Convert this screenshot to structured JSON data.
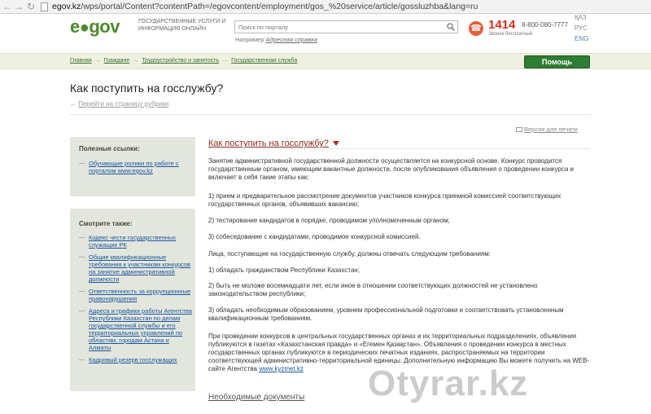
{
  "browser": {
    "url_host": "egov.kz",
    "url_path": "/wps/portal/Content?contentPath=/egovcontent/employment/gos_%20service/article/gossluzhba&lang=ru"
  },
  "header": {
    "logo_prefix": "e",
    "logo_dot": "●",
    "logo_suffix": "gov",
    "tagline": "Государственные услуги и информация онлайн",
    "search_placeholder": "Поиск по порталу",
    "example_label": "Например",
    "example_link": "Адресная справка",
    "hotline": "1414",
    "hotline_number": "8-800-080-7777",
    "hotline_sub": "Звонок бесплатный",
    "lang_kaz": "ҚАЗ",
    "lang_rus": "РУС",
    "lang_eng": "ENG"
  },
  "breadcrumb": {
    "items": [
      "Главная",
      "Гражданe",
      "Трудоустройство и занятость",
      "Государственная служба"
    ],
    "arrow": "→"
  },
  "help_button": "Помощь",
  "page": {
    "title": "Как поступить на госслужбу?",
    "back_arrow": "←",
    "back_link": "Перейти на страницу рубрики",
    "print_link": "Версия для печати"
  },
  "sidebar": {
    "useful_title": "Полезные ссылки:",
    "useful_links": [
      "Обучающие ролики по работе с порталом www.egov.kz"
    ],
    "see_also_title": "Смотрите также:",
    "see_also_links": [
      "Кодекс чести государственных служащих РК",
      "Общие квалификационные требования к участникам конкурсов на занятие административной должности",
      "Ответственность за коррупционные правонарушения",
      "Адреса и графики работы Агентства Республики Казахстан по делам государственной службы и его территориальных управлений по областям, городам Астана и Алматы",
      "Кадровый резерв госслужащих"
    ]
  },
  "article": {
    "title": "Как поступить на госслужбу?",
    "p1": "Занятие административной государственной должности осуществляется на конкурсной основе. Конкурс проводится государственным органом, имеющим вакантные должности, после опубликования объявления о проведении конкурса и включает в себя такие этапы как:",
    "p2": "1) прием и предварительное рассмотрение документов участников конкурса приемной комиссией соответствующих государственных органов, объявивших вакансию;",
    "p3": "2) тестирование кандидатов в порядке, проводимом уполномоченным органом;",
    "p4": "3) собеседование с кандидатами, проводимое конкурсной комиссией.",
    "p5": "Лица, поступающие на государственную службу, должны отвечать следующим требованиям:",
    "p6": "1) обладать гражданством Республики Казахстан;",
    "p7": "2) быть не моложе восемнадцати лет, если иное в отношении соответствующих должностей не установлено законодательством республики;",
    "p8": "3) обладать необходимым образованием, уровнем профессиональной подготовки и соответствовать установленным квалификационным требованиям.",
    "p9": "При проведении конкурсов в центральных государственных органах и их территориальных подразделениях, объявления публикуются в газетах «Казахстанская правда» и «Егемен Қазақстан». Объявления о проведении конкурса в местных государственных органах публикуются в периодических печатных изданиях, распространяемых на территории соответствующей административно-территориальной единицы. Дополнительную информацию Вы можете получить на WEB-сайте Агентства",
    "p9_link": "www.kyzmet.kz",
    "more_docs": "Необходимые документы"
  },
  "watermark": "Otyrar.kz"
}
